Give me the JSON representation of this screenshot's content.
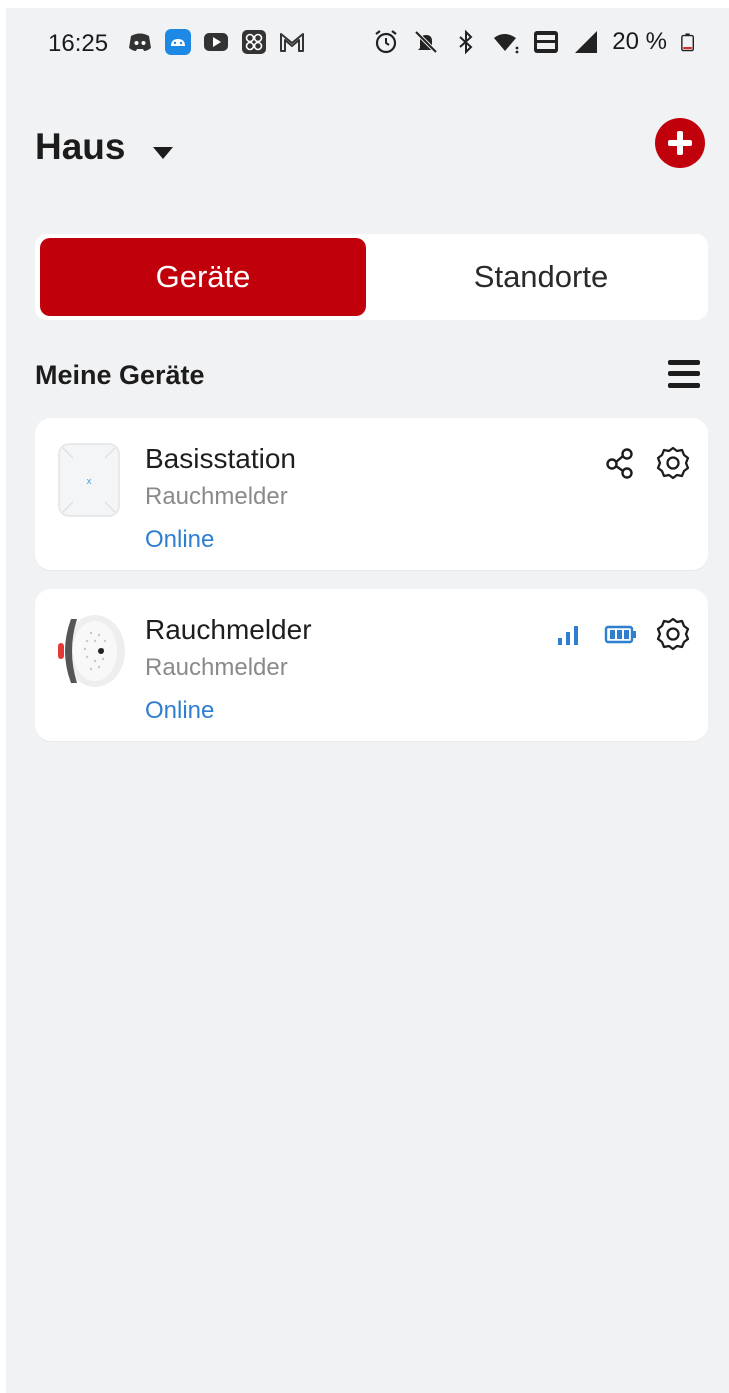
{
  "status_bar": {
    "time": "16:25",
    "battery_percent": "20 %",
    "left_icons": [
      "discord-icon",
      "android-app-icon",
      "youtube-icon",
      "app-grid-icon",
      "gmail-icon"
    ],
    "right_icons": [
      "alarm-icon",
      "mute-icon",
      "bluetooth-icon",
      "wifi-icon",
      "vowifi-icon",
      "signal-icon",
      "battery-icon"
    ]
  },
  "header": {
    "title": "Haus",
    "add_icon": "plus-circle-icon"
  },
  "tabs": [
    {
      "label": "Geräte",
      "active": true
    },
    {
      "label": "Standorte",
      "active": false
    }
  ],
  "section": {
    "title": "Meine Geräte",
    "menu_icon": "menu-icon"
  },
  "devices": [
    {
      "name": "Basisstation",
      "type": "Rauchmelder",
      "status": "Online",
      "icons": [
        "share-icon",
        "gear-icon"
      ]
    },
    {
      "name": "Rauchmelder",
      "type": "Rauchmelder",
      "status": "Online",
      "icons": [
        "signal-strength-icon",
        "battery-icon",
        "gear-icon"
      ]
    }
  ],
  "colors": {
    "accent": "#c0000a",
    "status_online": "#2f7fd0",
    "background": "#f1f2f4"
  }
}
